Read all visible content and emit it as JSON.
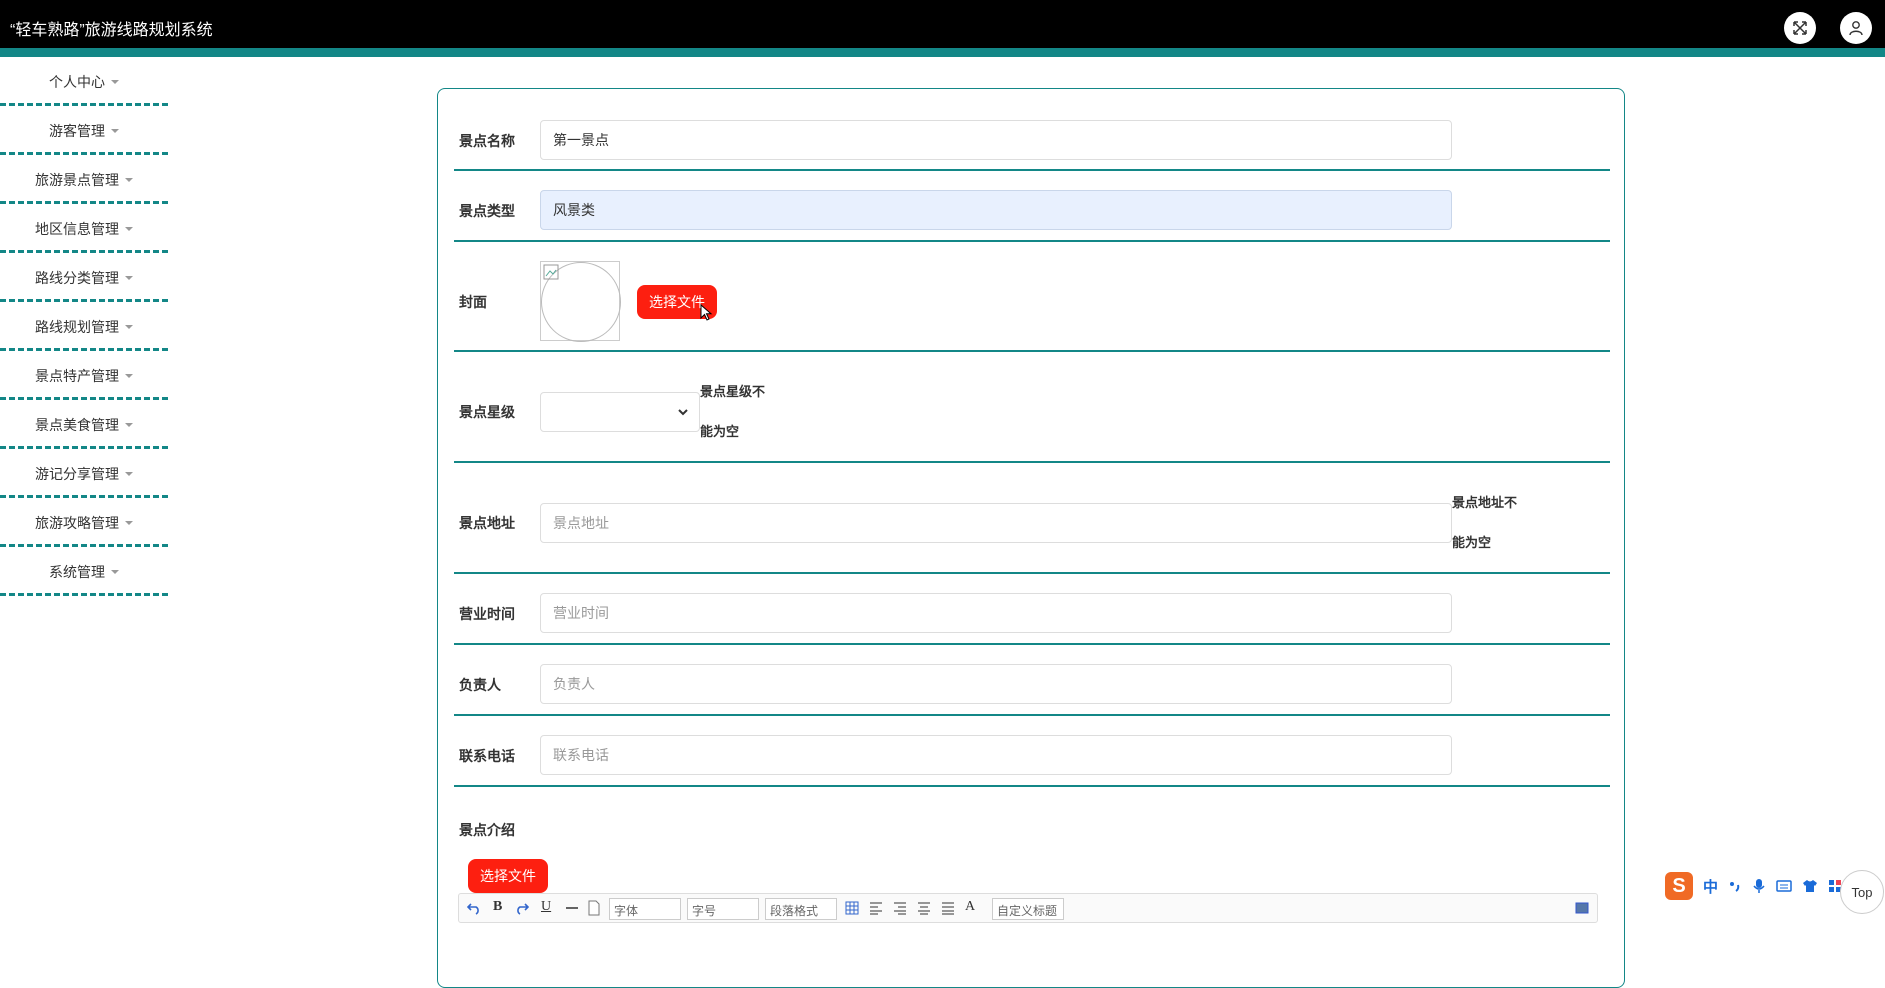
{
  "app": {
    "title": "“轻车熟路”旅游线路规划系统"
  },
  "header_icons": {
    "fullscreen": "fullscreen-icon",
    "user": "user-icon"
  },
  "sidebar": {
    "items": [
      {
        "label": "个人中心"
      },
      {
        "label": "游客管理"
      },
      {
        "label": "旅游景点管理"
      },
      {
        "label": "地区信息管理"
      },
      {
        "label": "路线分类管理"
      },
      {
        "label": "路线规划管理"
      },
      {
        "label": "景点特产管理"
      },
      {
        "label": "景点美食管理"
      },
      {
        "label": "游记分享管理"
      },
      {
        "label": "旅游攻略管理"
      },
      {
        "label": "系统管理"
      }
    ]
  },
  "form": {
    "name": {
      "label": "景点名称",
      "value": "第一景点"
    },
    "type": {
      "label": "景点类型",
      "value": "风景类"
    },
    "cover": {
      "label": "封面",
      "button": "选择文件"
    },
    "star": {
      "label": "景点星级",
      "error_1": "景点星级不",
      "error_2": "能为空"
    },
    "address": {
      "label": "景点地址",
      "placeholder": "景点地址",
      "error_1": "景点地址不",
      "error_2": "能为空"
    },
    "hours": {
      "label": "营业时间",
      "placeholder": "营业时间"
    },
    "manager": {
      "label": "负责人",
      "placeholder": "负责人"
    },
    "phone": {
      "label": "联系电话",
      "placeholder": "联系电话"
    },
    "intro": {
      "label": "景点介绍",
      "button": "选择文件"
    }
  },
  "editor": {
    "font_family": "字体",
    "font_size": "字号",
    "paragraph": "段落格式",
    "custom_title": "自定义标题",
    "bold": "B",
    "underline": "U",
    "font_color": "A"
  },
  "ime": {
    "mode": "中"
  },
  "back_to_top": "Top",
  "colors": {
    "accent": "#138787",
    "button": "#fd1f10",
    "topbar": "#000000"
  }
}
